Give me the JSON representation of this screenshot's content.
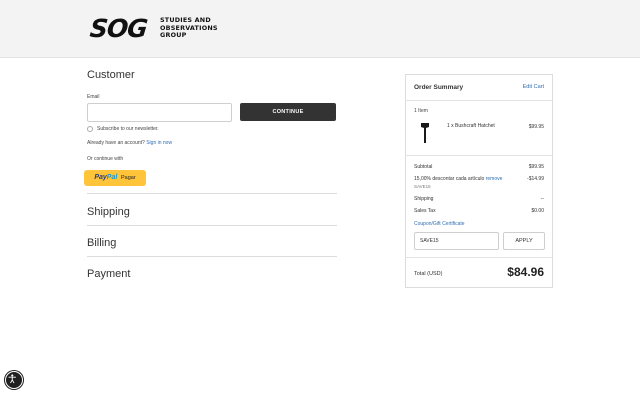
{
  "brand": {
    "logo_mark": "SOG",
    "logo_text": "Studies and Observations Group",
    "logo_lines": [
      "STUDIES AND",
      "OBSERVATIONS",
      "GROUP"
    ]
  },
  "customer": {
    "title": "Customer",
    "email_label": "Email",
    "email_value": "",
    "continue_label": "CONTINUE",
    "subscribe_label": "Subscribe to our newsletter.",
    "already_text": "Already have an account?",
    "signin_label": "Sign in now",
    "or_continue": "Or continue with",
    "paypal_pay": "Pay",
    "paypal_pal": "Pal",
    "paypal_pagar": "Pagar"
  },
  "steps": [
    "Shipping",
    "Billing",
    "Payment"
  ],
  "order_summary": {
    "title": "Order Summary",
    "edit_cart": "Edit Cart",
    "items_count": "1 Item",
    "product": {
      "name": "1 x Bushcraft Hatchet",
      "price": "$99.95",
      "image_icon": "hatchet-icon"
    },
    "subtotal_label": "Subtotal",
    "subtotal_value": "$99.95",
    "discount_label": "15,00% descontar cada artículo",
    "discount_remove": "remove",
    "discount_value": "-$14.99",
    "discount_code": "SAVE15",
    "shipping_label": "Shipping",
    "shipping_value": "--",
    "tax_label": "Sales Tax",
    "tax_value": "$0.00",
    "coupon_link": "Coupon/Gift Certificate",
    "coupon_value": "SAVE15",
    "apply_label": "APPLY",
    "total_label": "Total (USD)",
    "total_value": "$84.96"
  },
  "accessibility": {
    "icon": "accessibility-icon"
  },
  "colors": {
    "link": "#2f6fb5",
    "button_dark": "#333333",
    "paypal": "#ffc439",
    "header_bg": "#f3f3f3"
  }
}
